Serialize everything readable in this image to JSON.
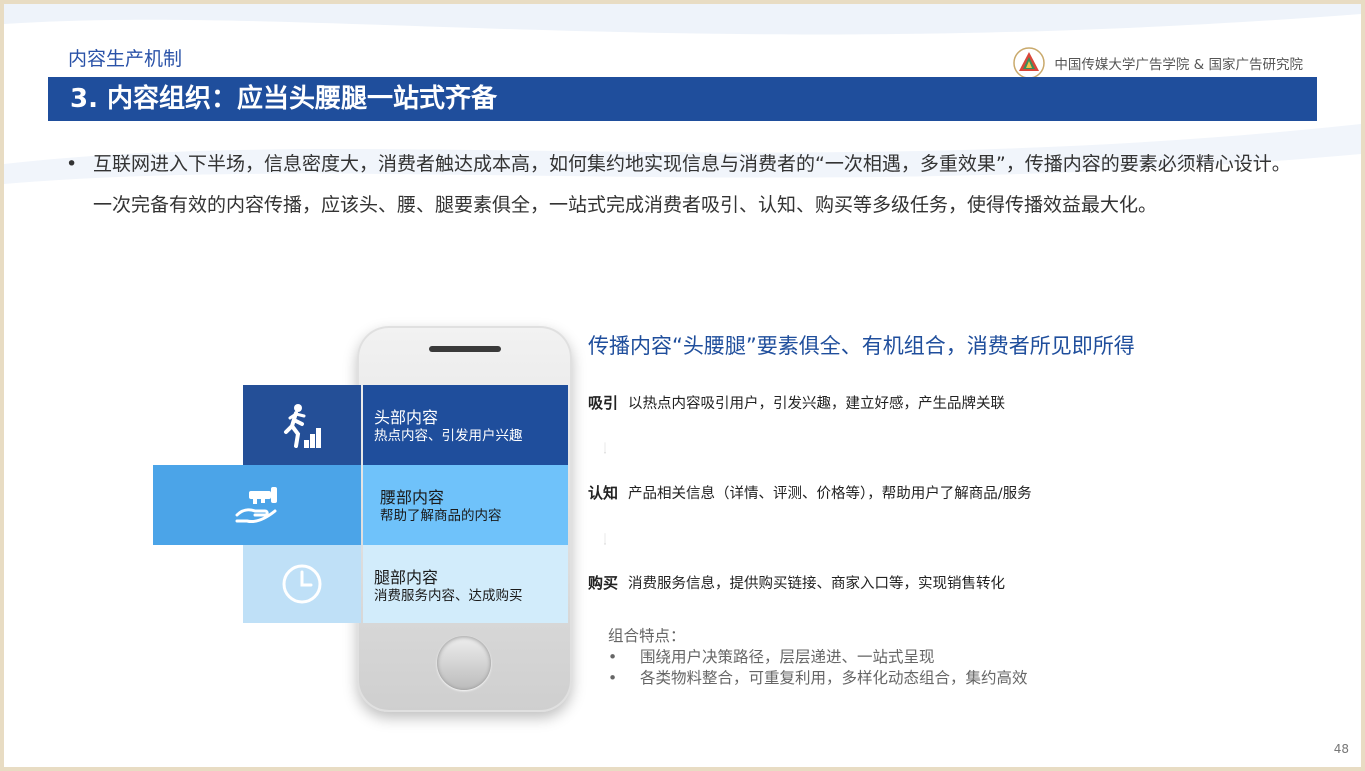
{
  "header": {
    "section": "内容生产机制",
    "org": "中国传媒大学广告学院 & 国家广告研究院",
    "title": "3. 内容组织：应当头腰腿一站式齐备"
  },
  "intro": {
    "bullet": "•",
    "text": "互联网进入下半场，信息密度大，消费者触达成本高，如何集约地实现信息与消费者的“一次相遇，多重效果”，传播内容的要素必须精心设计。一次完备有效的内容传播，应该头、腰、腿要素俱全，一站式完成消费者吸引、认知、购买等多级任务，使得传播效益最大化。"
  },
  "phone_bars": [
    {
      "title": "头部内容",
      "sub": "热点内容、引发用户兴趣",
      "icon": "running-stairs-icon"
    },
    {
      "title": "腰部内容",
      "sub": "帮助了解商品的内容",
      "icon": "hand-key-icon"
    },
    {
      "title": "腿部内容",
      "sub": "消费服务内容、达成购买",
      "icon": "clock-icon"
    }
  ],
  "subtitle": "传播内容“头腰腿”要素俱全、有机组合，消费者所见即所得",
  "stages": [
    {
      "key": "吸引",
      "desc": "以热点内容吸引用户，引发兴趣，建立好感，产生品牌关联"
    },
    {
      "key": "认知",
      "desc": "产品相关信息（详情、评测、价格等），帮助用户了解商品/服务"
    },
    {
      "key": "购买",
      "desc": "消费服务信息，提供购买链接、商家入口等，实现销售转化"
    }
  ],
  "features": {
    "heading": "组合特点：",
    "bullet": "•",
    "items": [
      "围绕用户决策路径，层层递进、一站式呈现",
      "各类物料整合，可重复利用，多样化动态组合，集约高效"
    ]
  },
  "page_number": "48",
  "colors": {
    "title_bar": "#1f4e9c",
    "head_bar": "#1f4e9c",
    "waist_bar": "#6fc2fa",
    "leg_bar": "#d2ecfb"
  }
}
